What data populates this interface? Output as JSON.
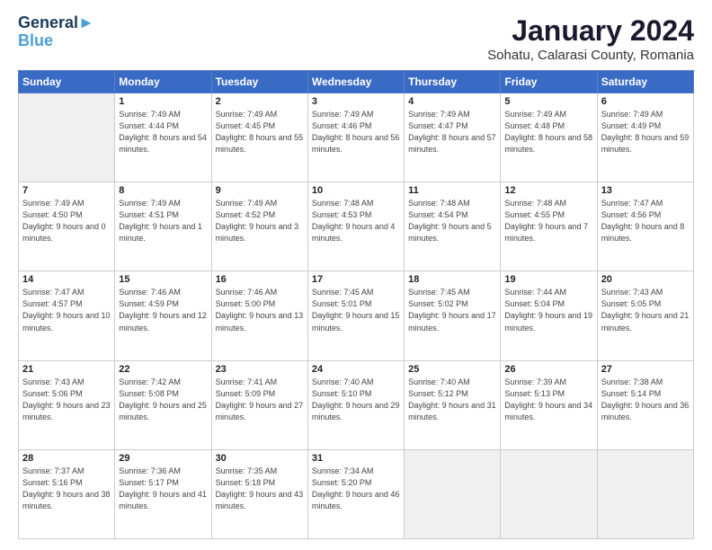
{
  "header": {
    "logo_line1": "General",
    "logo_line2": "Blue",
    "title": "January 2024",
    "subtitle": "Sohatu, Calarasi County, Romania"
  },
  "weekdays": [
    "Sunday",
    "Monday",
    "Tuesday",
    "Wednesday",
    "Thursday",
    "Friday",
    "Saturday"
  ],
  "weeks": [
    [
      {
        "day": "",
        "sunrise": "",
        "sunset": "",
        "daylight": "",
        "empty": true
      },
      {
        "day": "1",
        "sunrise": "Sunrise: 7:49 AM",
        "sunset": "Sunset: 4:44 PM",
        "daylight": "Daylight: 8 hours and 54 minutes."
      },
      {
        "day": "2",
        "sunrise": "Sunrise: 7:49 AM",
        "sunset": "Sunset: 4:45 PM",
        "daylight": "Daylight: 8 hours and 55 minutes."
      },
      {
        "day": "3",
        "sunrise": "Sunrise: 7:49 AM",
        "sunset": "Sunset: 4:46 PM",
        "daylight": "Daylight: 8 hours and 56 minutes."
      },
      {
        "day": "4",
        "sunrise": "Sunrise: 7:49 AM",
        "sunset": "Sunset: 4:47 PM",
        "daylight": "Daylight: 8 hours and 57 minutes."
      },
      {
        "day": "5",
        "sunrise": "Sunrise: 7:49 AM",
        "sunset": "Sunset: 4:48 PM",
        "daylight": "Daylight: 8 hours and 58 minutes."
      },
      {
        "day": "6",
        "sunrise": "Sunrise: 7:49 AM",
        "sunset": "Sunset: 4:49 PM",
        "daylight": "Daylight: 8 hours and 59 minutes."
      }
    ],
    [
      {
        "day": "7",
        "sunrise": "Sunrise: 7:49 AM",
        "sunset": "Sunset: 4:50 PM",
        "daylight": "Daylight: 9 hours and 0 minutes."
      },
      {
        "day": "8",
        "sunrise": "Sunrise: 7:49 AM",
        "sunset": "Sunset: 4:51 PM",
        "daylight": "Daylight: 9 hours and 1 minute."
      },
      {
        "day": "9",
        "sunrise": "Sunrise: 7:49 AM",
        "sunset": "Sunset: 4:52 PM",
        "daylight": "Daylight: 9 hours and 3 minutes."
      },
      {
        "day": "10",
        "sunrise": "Sunrise: 7:48 AM",
        "sunset": "Sunset: 4:53 PM",
        "daylight": "Daylight: 9 hours and 4 minutes."
      },
      {
        "day": "11",
        "sunrise": "Sunrise: 7:48 AM",
        "sunset": "Sunset: 4:54 PM",
        "daylight": "Daylight: 9 hours and 5 minutes."
      },
      {
        "day": "12",
        "sunrise": "Sunrise: 7:48 AM",
        "sunset": "Sunset: 4:55 PM",
        "daylight": "Daylight: 9 hours and 7 minutes."
      },
      {
        "day": "13",
        "sunrise": "Sunrise: 7:47 AM",
        "sunset": "Sunset: 4:56 PM",
        "daylight": "Daylight: 9 hours and 8 minutes."
      }
    ],
    [
      {
        "day": "14",
        "sunrise": "Sunrise: 7:47 AM",
        "sunset": "Sunset: 4:57 PM",
        "daylight": "Daylight: 9 hours and 10 minutes."
      },
      {
        "day": "15",
        "sunrise": "Sunrise: 7:46 AM",
        "sunset": "Sunset: 4:59 PM",
        "daylight": "Daylight: 9 hours and 12 minutes."
      },
      {
        "day": "16",
        "sunrise": "Sunrise: 7:46 AM",
        "sunset": "Sunset: 5:00 PM",
        "daylight": "Daylight: 9 hours and 13 minutes."
      },
      {
        "day": "17",
        "sunrise": "Sunrise: 7:45 AM",
        "sunset": "Sunset: 5:01 PM",
        "daylight": "Daylight: 9 hours and 15 minutes."
      },
      {
        "day": "18",
        "sunrise": "Sunrise: 7:45 AM",
        "sunset": "Sunset: 5:02 PM",
        "daylight": "Daylight: 9 hours and 17 minutes."
      },
      {
        "day": "19",
        "sunrise": "Sunrise: 7:44 AM",
        "sunset": "Sunset: 5:04 PM",
        "daylight": "Daylight: 9 hours and 19 minutes."
      },
      {
        "day": "20",
        "sunrise": "Sunrise: 7:43 AM",
        "sunset": "Sunset: 5:05 PM",
        "daylight": "Daylight: 9 hours and 21 minutes."
      }
    ],
    [
      {
        "day": "21",
        "sunrise": "Sunrise: 7:43 AM",
        "sunset": "Sunset: 5:06 PM",
        "daylight": "Daylight: 9 hours and 23 minutes."
      },
      {
        "day": "22",
        "sunrise": "Sunrise: 7:42 AM",
        "sunset": "Sunset: 5:08 PM",
        "daylight": "Daylight: 9 hours and 25 minutes."
      },
      {
        "day": "23",
        "sunrise": "Sunrise: 7:41 AM",
        "sunset": "Sunset: 5:09 PM",
        "daylight": "Daylight: 9 hours and 27 minutes."
      },
      {
        "day": "24",
        "sunrise": "Sunrise: 7:40 AM",
        "sunset": "Sunset: 5:10 PM",
        "daylight": "Daylight: 9 hours and 29 minutes."
      },
      {
        "day": "25",
        "sunrise": "Sunrise: 7:40 AM",
        "sunset": "Sunset: 5:12 PM",
        "daylight": "Daylight: 9 hours and 31 minutes."
      },
      {
        "day": "26",
        "sunrise": "Sunrise: 7:39 AM",
        "sunset": "Sunset: 5:13 PM",
        "daylight": "Daylight: 9 hours and 34 minutes."
      },
      {
        "day": "27",
        "sunrise": "Sunrise: 7:38 AM",
        "sunset": "Sunset: 5:14 PM",
        "daylight": "Daylight: 9 hours and 36 minutes."
      }
    ],
    [
      {
        "day": "28",
        "sunrise": "Sunrise: 7:37 AM",
        "sunset": "Sunset: 5:16 PM",
        "daylight": "Daylight: 9 hours and 38 minutes."
      },
      {
        "day": "29",
        "sunrise": "Sunrise: 7:36 AM",
        "sunset": "Sunset: 5:17 PM",
        "daylight": "Daylight: 9 hours and 41 minutes."
      },
      {
        "day": "30",
        "sunrise": "Sunrise: 7:35 AM",
        "sunset": "Sunset: 5:18 PM",
        "daylight": "Daylight: 9 hours and 43 minutes."
      },
      {
        "day": "31",
        "sunrise": "Sunrise: 7:34 AM",
        "sunset": "Sunset: 5:20 PM",
        "daylight": "Daylight: 9 hours and 46 minutes."
      },
      {
        "day": "",
        "sunrise": "",
        "sunset": "",
        "daylight": "",
        "empty": true
      },
      {
        "day": "",
        "sunrise": "",
        "sunset": "",
        "daylight": "",
        "empty": true
      },
      {
        "day": "",
        "sunrise": "",
        "sunset": "",
        "daylight": "",
        "empty": true
      }
    ]
  ]
}
